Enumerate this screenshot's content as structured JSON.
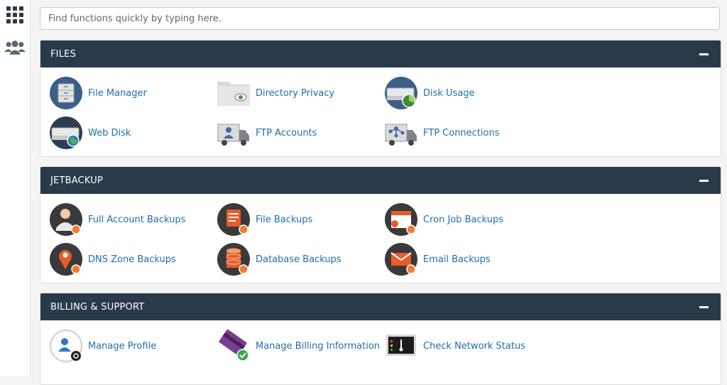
{
  "search": {
    "placeholder": "Find functions quickly by typing here."
  },
  "sections": {
    "files": {
      "title": "FILES",
      "items": [
        "File Manager",
        "Directory Privacy",
        "Disk Usage",
        "Web Disk",
        "FTP Accounts",
        "FTP Connections"
      ]
    },
    "jetbackup": {
      "title": "JETBACKUP",
      "items": [
        "Full Account Backups",
        "File Backups",
        "Cron Job Backups",
        "DNS Zone Backups",
        "Database Backups",
        "Email Backups"
      ]
    },
    "billing": {
      "title": "BILLING & SUPPORT",
      "items": [
        "Manage Profile",
        "Manage Billing Information",
        "Check Network Status"
      ]
    }
  },
  "colors": {
    "header": "#293a4a",
    "link": "#1f6fa8",
    "jetbackup_badge": "#f07c33"
  }
}
